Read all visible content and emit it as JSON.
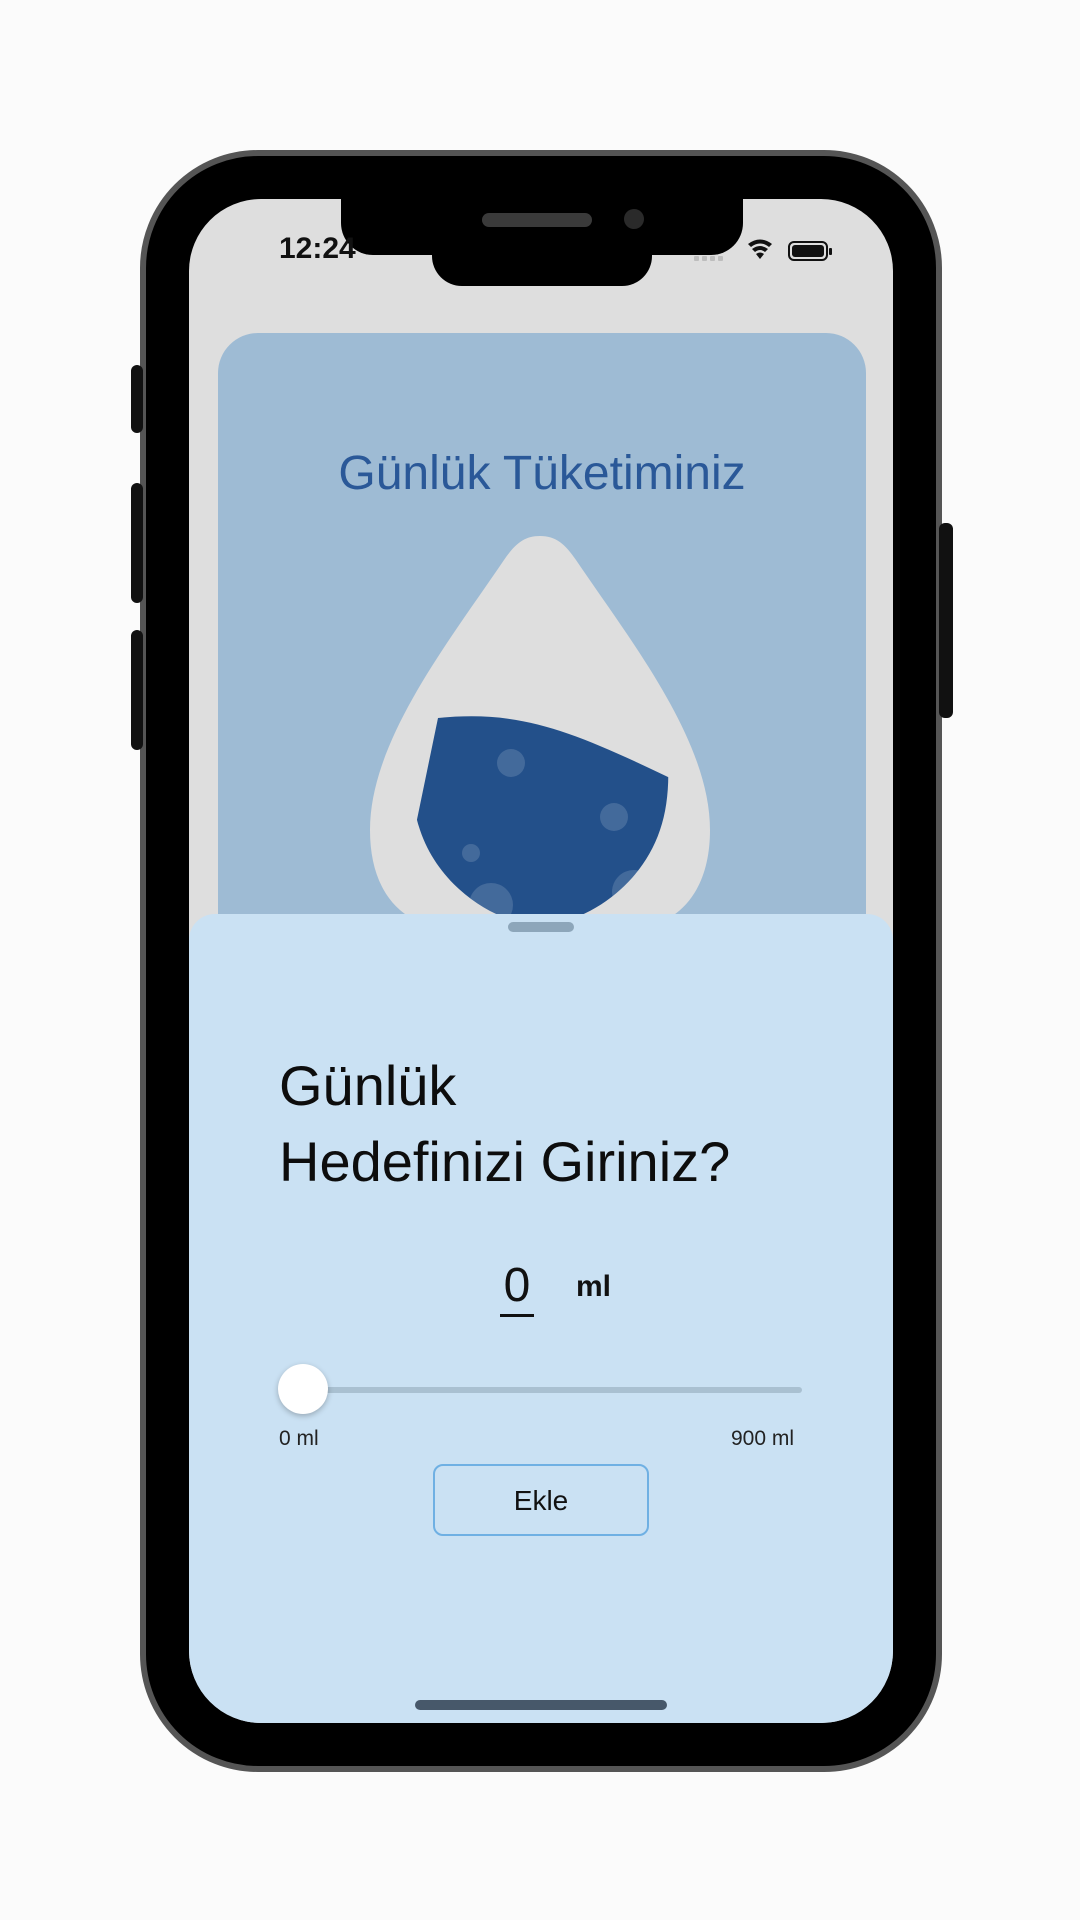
{
  "status_bar": {
    "time": "12:24",
    "icons": [
      "cellular-icon",
      "wifi-icon",
      "battery-icon"
    ]
  },
  "consumption_card": {
    "title": "Günlük Tüketiminiz",
    "fill_fraction": 0.55,
    "drop_color": "#dedede",
    "water_color": "#23508a"
  },
  "goal_sheet": {
    "title_line1": "Günlük",
    "title_line2": "Hedefinizi Giriniz?",
    "amount_value": "0",
    "amount_unit": "ml",
    "slider": {
      "value": 0,
      "min": 0,
      "max": 900,
      "min_label": "0 ml",
      "max_label": "900 ml"
    },
    "add_button_label": "Ekle"
  },
  "colors": {
    "card_bg": "#9ebbd4",
    "sheet_bg": "#cae1f3",
    "title_blue": "#2a5898",
    "button_border": "#6fb0e3"
  }
}
